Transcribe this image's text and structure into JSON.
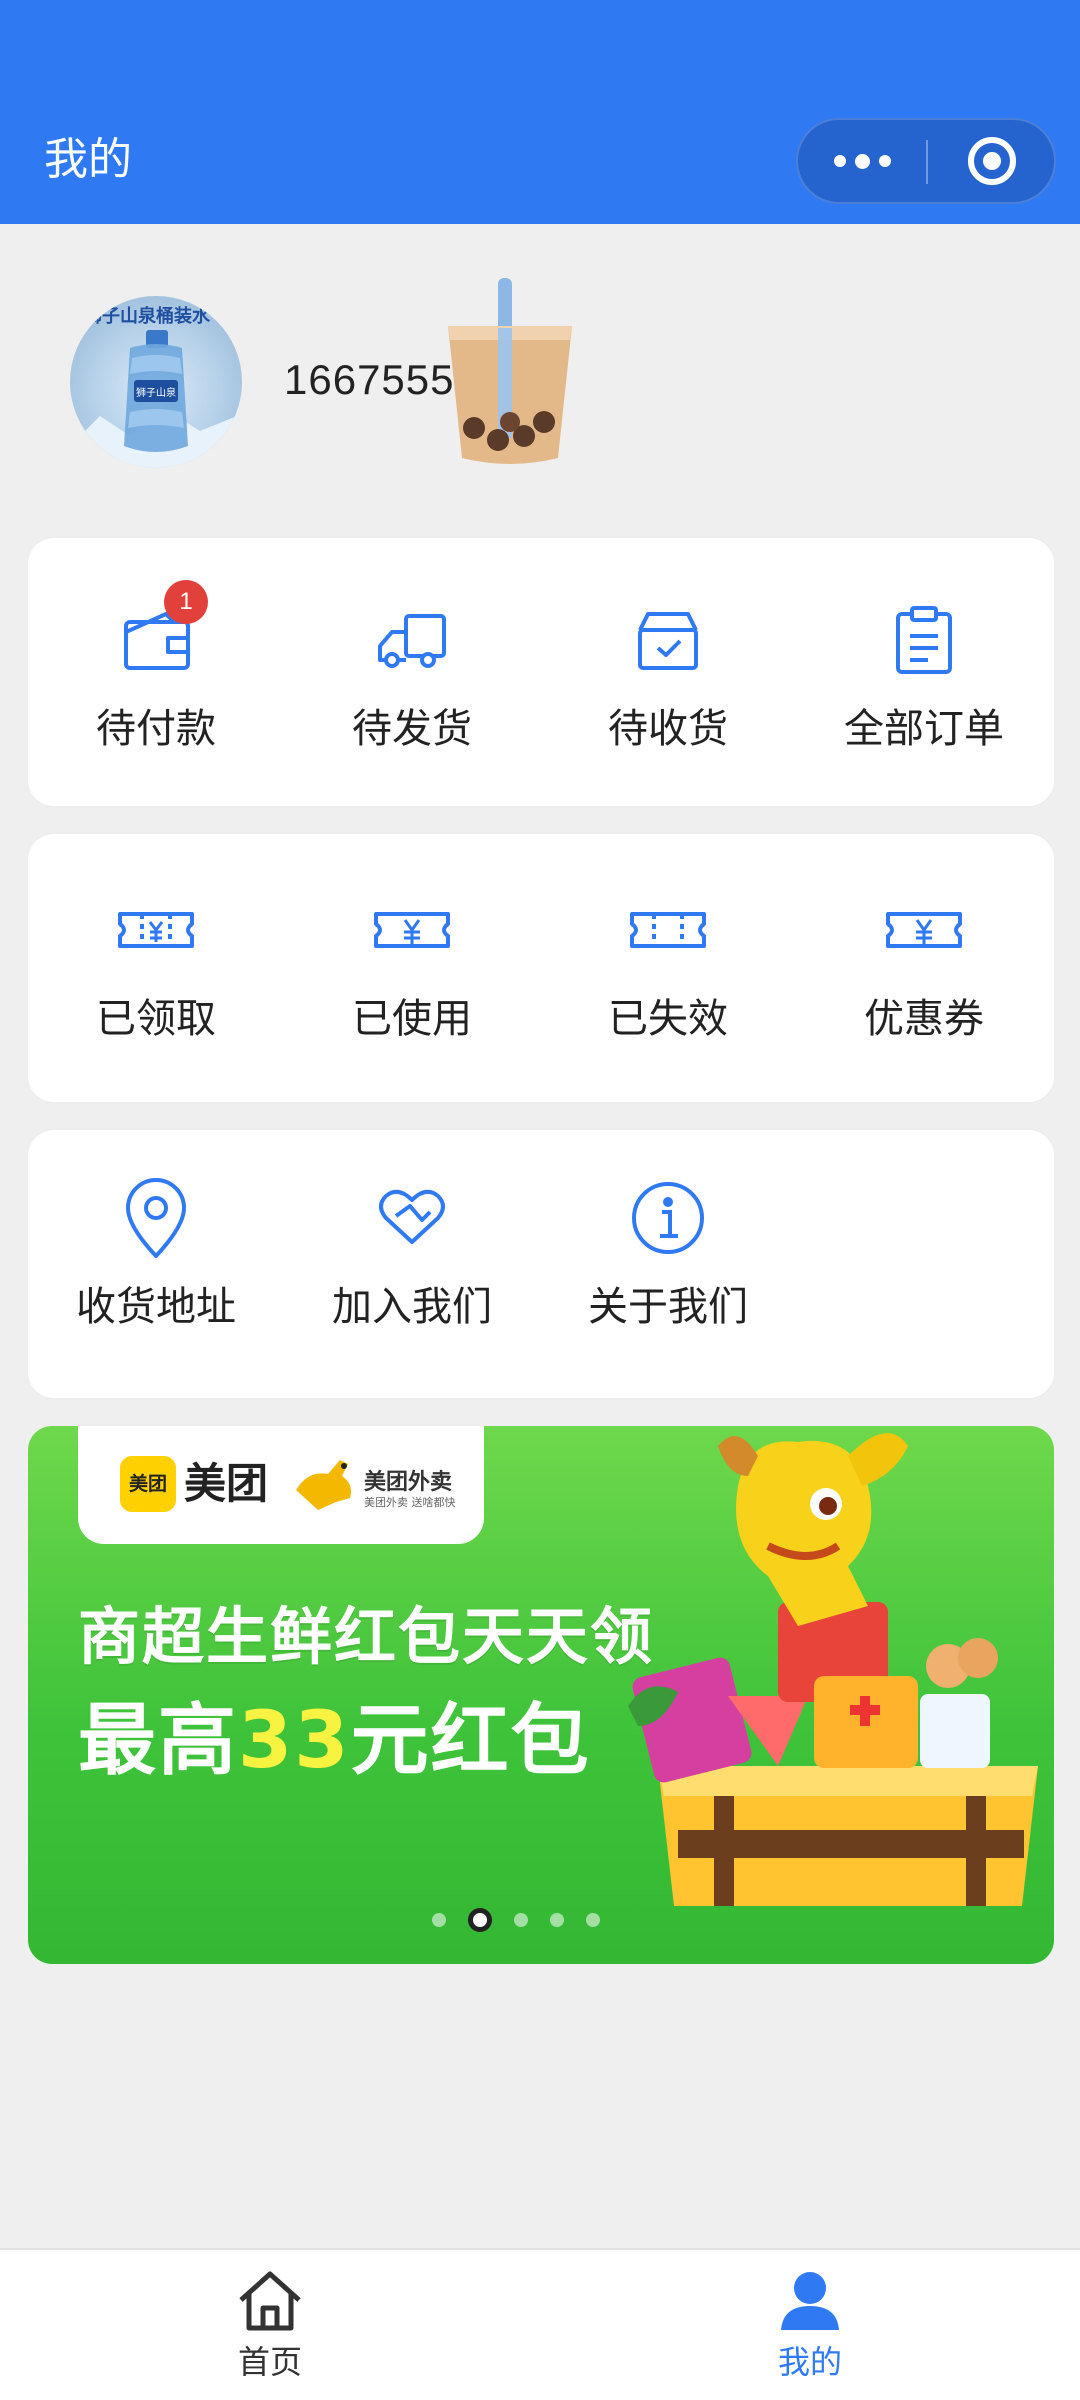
{
  "header": {
    "title": "我的"
  },
  "profile": {
    "avatar_brand": "狮子山泉桶装水",
    "phone": "16675552"
  },
  "orders": {
    "items": [
      {
        "label": "待付款",
        "icon": "wallet-icon",
        "badge": "1"
      },
      {
        "label": "待发货",
        "icon": "truck-icon"
      },
      {
        "label": "待收货",
        "icon": "box-icon"
      },
      {
        "label": "全部订单",
        "icon": "clipboard-icon"
      }
    ]
  },
  "coupons": {
    "items": [
      {
        "label": "已领取",
        "icon": "coupon-received-icon"
      },
      {
        "label": "已使用",
        "icon": "coupon-used-icon"
      },
      {
        "label": "已失效",
        "icon": "coupon-expired-icon"
      },
      {
        "label": "优惠券",
        "icon": "coupon-icon"
      }
    ]
  },
  "services": {
    "items": [
      {
        "label": "收货地址",
        "icon": "location-icon"
      },
      {
        "label": "加入我们",
        "icon": "handshake-heart-icon"
      },
      {
        "label": "关于我们",
        "icon": "info-icon"
      }
    ]
  },
  "banner": {
    "meituan_logo": "美团",
    "meituan_text": "美团",
    "waimai_text": "美团外卖",
    "waimai_sub": "美团外卖 送啥都快",
    "line1": "商超生鲜红包天天领",
    "line2_prefix": "最高",
    "line2_highlight": "33",
    "line2_suffix": "元红包",
    "page_count": 5,
    "active_page": 2
  },
  "tabbar": {
    "items": [
      {
        "label": "首页",
        "icon": "home-icon",
        "active": false
      },
      {
        "label": "我的",
        "icon": "user-icon",
        "active": true
      }
    ]
  },
  "colors": {
    "primary": "#2f7af2",
    "icon_blue": "#2f7af2",
    "badge_red": "#e2403b",
    "tab_inactive": "#333333"
  }
}
